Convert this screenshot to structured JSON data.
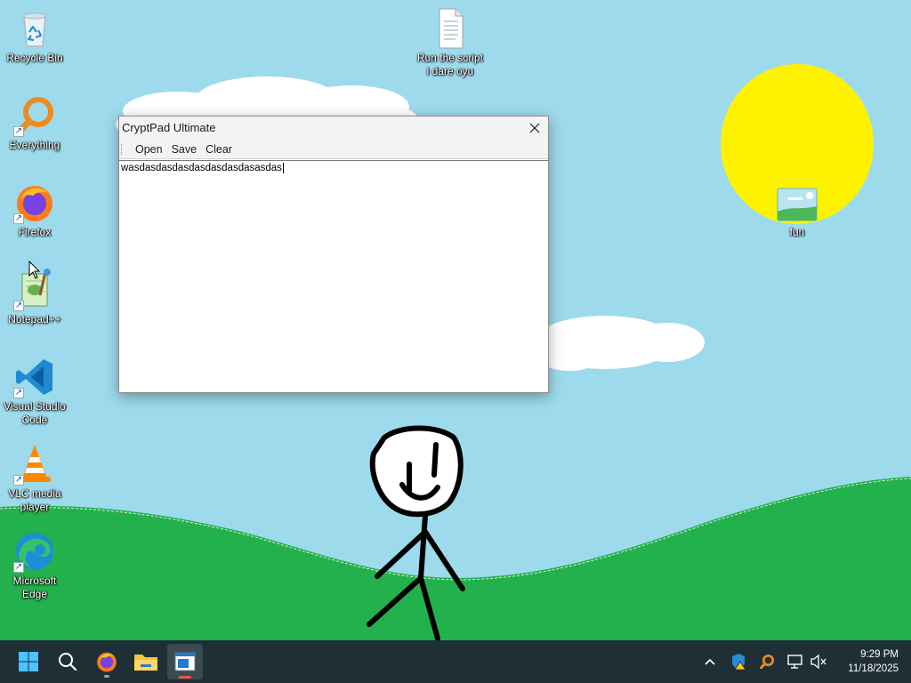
{
  "desktop": {
    "icons": [
      {
        "label": "Recycle Bin",
        "icon": "recycle-bin-icon",
        "shortcut": false
      },
      {
        "label": "Everything",
        "icon": "everything-search-icon",
        "shortcut": true
      },
      {
        "label": "Firefox",
        "icon": "firefox-icon",
        "shortcut": true
      },
      {
        "label": "Notepad++",
        "icon": "notepad-plus-plus-icon",
        "shortcut": true
      },
      {
        "label": "Visual Studio\nCode",
        "icon": "vscode-icon",
        "shortcut": true
      },
      {
        "label": "VLC media\nplayer",
        "icon": "vlc-icon",
        "shortcut": true
      },
      {
        "label": "Microsoft\nEdge",
        "icon": "edge-icon",
        "shortcut": true
      },
      {
        "label": "Run the script\ni dare oyu",
        "icon": "text-file-icon",
        "shortcut": false
      },
      {
        "label": "fun",
        "icon": "image-file-icon",
        "shortcut": false
      }
    ]
  },
  "window": {
    "title": "CryptPad Ultimate",
    "close_glyph": "✕",
    "menu": [
      "Open",
      "Save",
      "Clear"
    ],
    "editor_text": "wasdasdasdasdasdasdasdasasdas"
  },
  "taskbar": {
    "pinned": [
      {
        "name": "start-button",
        "icon": "windows-logo-icon"
      },
      {
        "name": "search-button",
        "icon": "search-icon"
      },
      {
        "name": "firefox-taskbar-button",
        "icon": "firefox-icon",
        "running": true
      },
      {
        "name": "file-explorer-taskbar-button",
        "icon": "folder-icon"
      },
      {
        "name": "cryptpad-taskbar-button",
        "icon": "app-window-icon",
        "active": true
      }
    ],
    "tray": {
      "chevron": "^",
      "icons": [
        "security-warning-icon",
        "everything-search-icon",
        "network-icon",
        "volume-muted-icon"
      ]
    },
    "clock": {
      "time": "9:29 PM",
      "date": "11/18/2025"
    }
  },
  "colors": {
    "sky": "#9ddaec",
    "grass": "#22b14c",
    "sun": "#fff200",
    "taskbar": "#1f2f36",
    "accent_active": "#e8534a"
  }
}
